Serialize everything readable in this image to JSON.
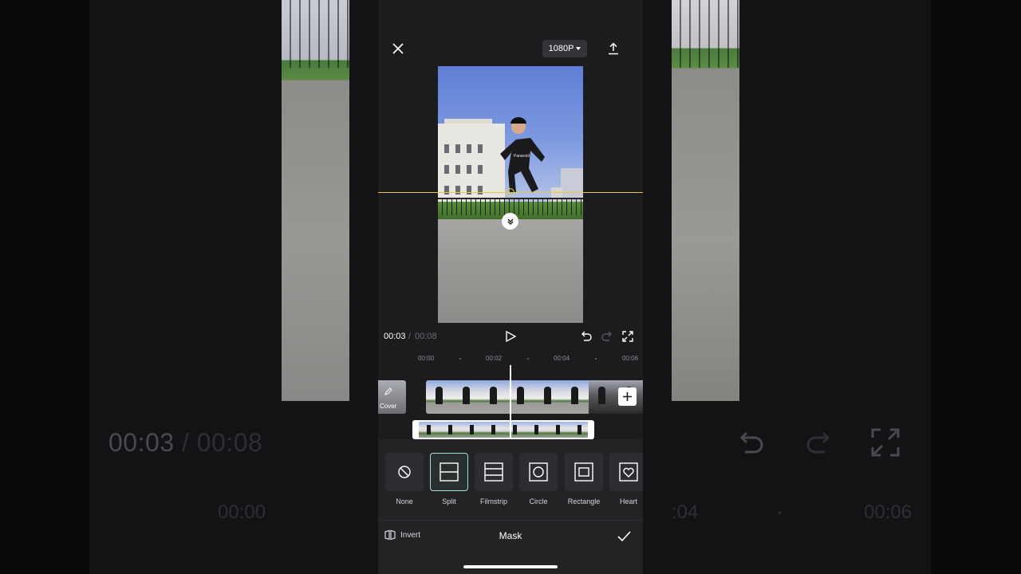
{
  "topbar": {
    "resolution": "1080P",
    "close_icon": "close-icon",
    "export_icon": "export-icon"
  },
  "preview": {
    "shirt_text": "Paranoid"
  },
  "playback": {
    "current_time": "00:03",
    "separator": "/",
    "total_time": "00:08"
  },
  "timeline": {
    "ticks": [
      "00:00",
      "00:02",
      "00:04",
      "00:06"
    ],
    "cover_label": "Cover"
  },
  "mask_options": [
    {
      "label": "None",
      "icon": "none-icon",
      "selected": false
    },
    {
      "label": "Split",
      "icon": "split-icon",
      "selected": true
    },
    {
      "label": "Filmstrip",
      "icon": "filmstrip-icon",
      "selected": false
    },
    {
      "label": "Circle",
      "icon": "circle-icon",
      "selected": false
    },
    {
      "label": "Rectangle",
      "icon": "rectangle-icon",
      "selected": false
    },
    {
      "label": "Heart",
      "icon": "heart-icon",
      "selected": false
    }
  ],
  "bottom_bar": {
    "invert_label": "Invert",
    "title": "Mask"
  },
  "backdrop": {
    "time_current": "00:03",
    "separator": "/",
    "time_total": "00:08",
    "ticks": [
      "00:00",
      ":04",
      "•",
      "00:06"
    ]
  },
  "colors": {
    "accent_mask_line": "#e6c84a",
    "selected_outline": "#9de0d0",
    "panel_bg": "#232326"
  }
}
